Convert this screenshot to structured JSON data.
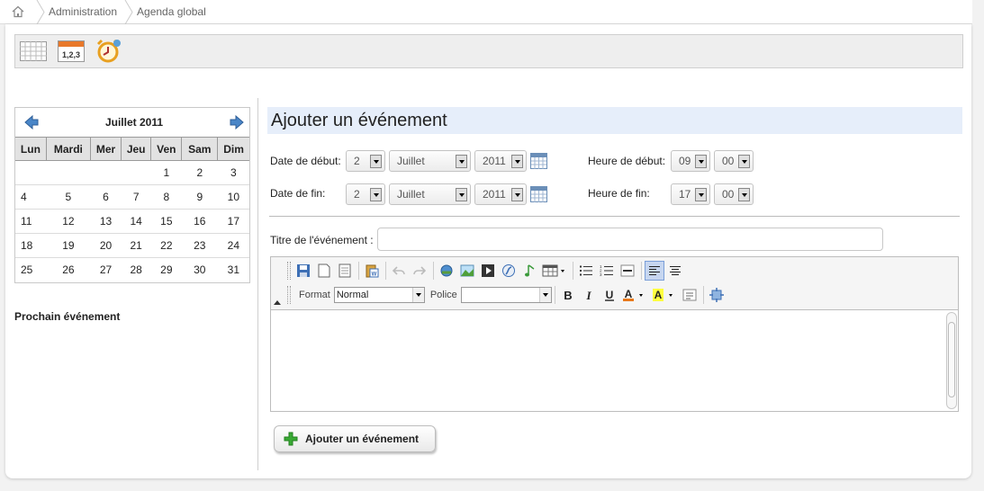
{
  "breadcrumb": {
    "items": [
      "Administration",
      "Agenda global"
    ]
  },
  "toolbar": {
    "icons": [
      "month-view-icon",
      "numbered-list-icon",
      "alarm-clock-icon"
    ]
  },
  "calendar": {
    "month_title": "Juillet 2011",
    "weekdays": [
      "Lun",
      "Mardi",
      "Mer",
      "Jeu",
      "Ven",
      "Sam",
      "Dim"
    ],
    "weeks": [
      [
        "",
        "",
        "",
        "",
        "1",
        "2",
        "3"
      ],
      [
        "4",
        "5",
        "6",
        "7",
        "8",
        "9",
        "10"
      ],
      [
        "11",
        "12",
        "13",
        "14",
        "15",
        "16",
        "17"
      ],
      [
        "18",
        "19",
        "20",
        "21",
        "22",
        "23",
        "24"
      ],
      [
        "25",
        "26",
        "27",
        "28",
        "29",
        "30",
        "31"
      ]
    ]
  },
  "next_event": {
    "label": "Prochain événement"
  },
  "form": {
    "title": "Ajouter un événement",
    "start_date_label": "Date de début:",
    "end_date_label": "Date de fin:",
    "start_time_label": "Heure de début:",
    "end_time_label": "Heure de fin:",
    "start": {
      "day": "2",
      "month": "Juillet",
      "year": "2011",
      "hour": "09",
      "minute": "00"
    },
    "end": {
      "day": "2",
      "month": "Juillet",
      "year": "2011",
      "hour": "17",
      "minute": "00"
    },
    "event_title_label": "Titre de l'événement :",
    "event_title_value": ""
  },
  "editor": {
    "format_label": "Format",
    "format_value": "Normal",
    "font_label": "Police",
    "font_value": ""
  },
  "submit": {
    "label": "Ajouter un événement"
  },
  "colors": {
    "accent": "#e6eefa",
    "arrow_blue": "#4a86c8",
    "plus_green": "#3aaa35"
  }
}
